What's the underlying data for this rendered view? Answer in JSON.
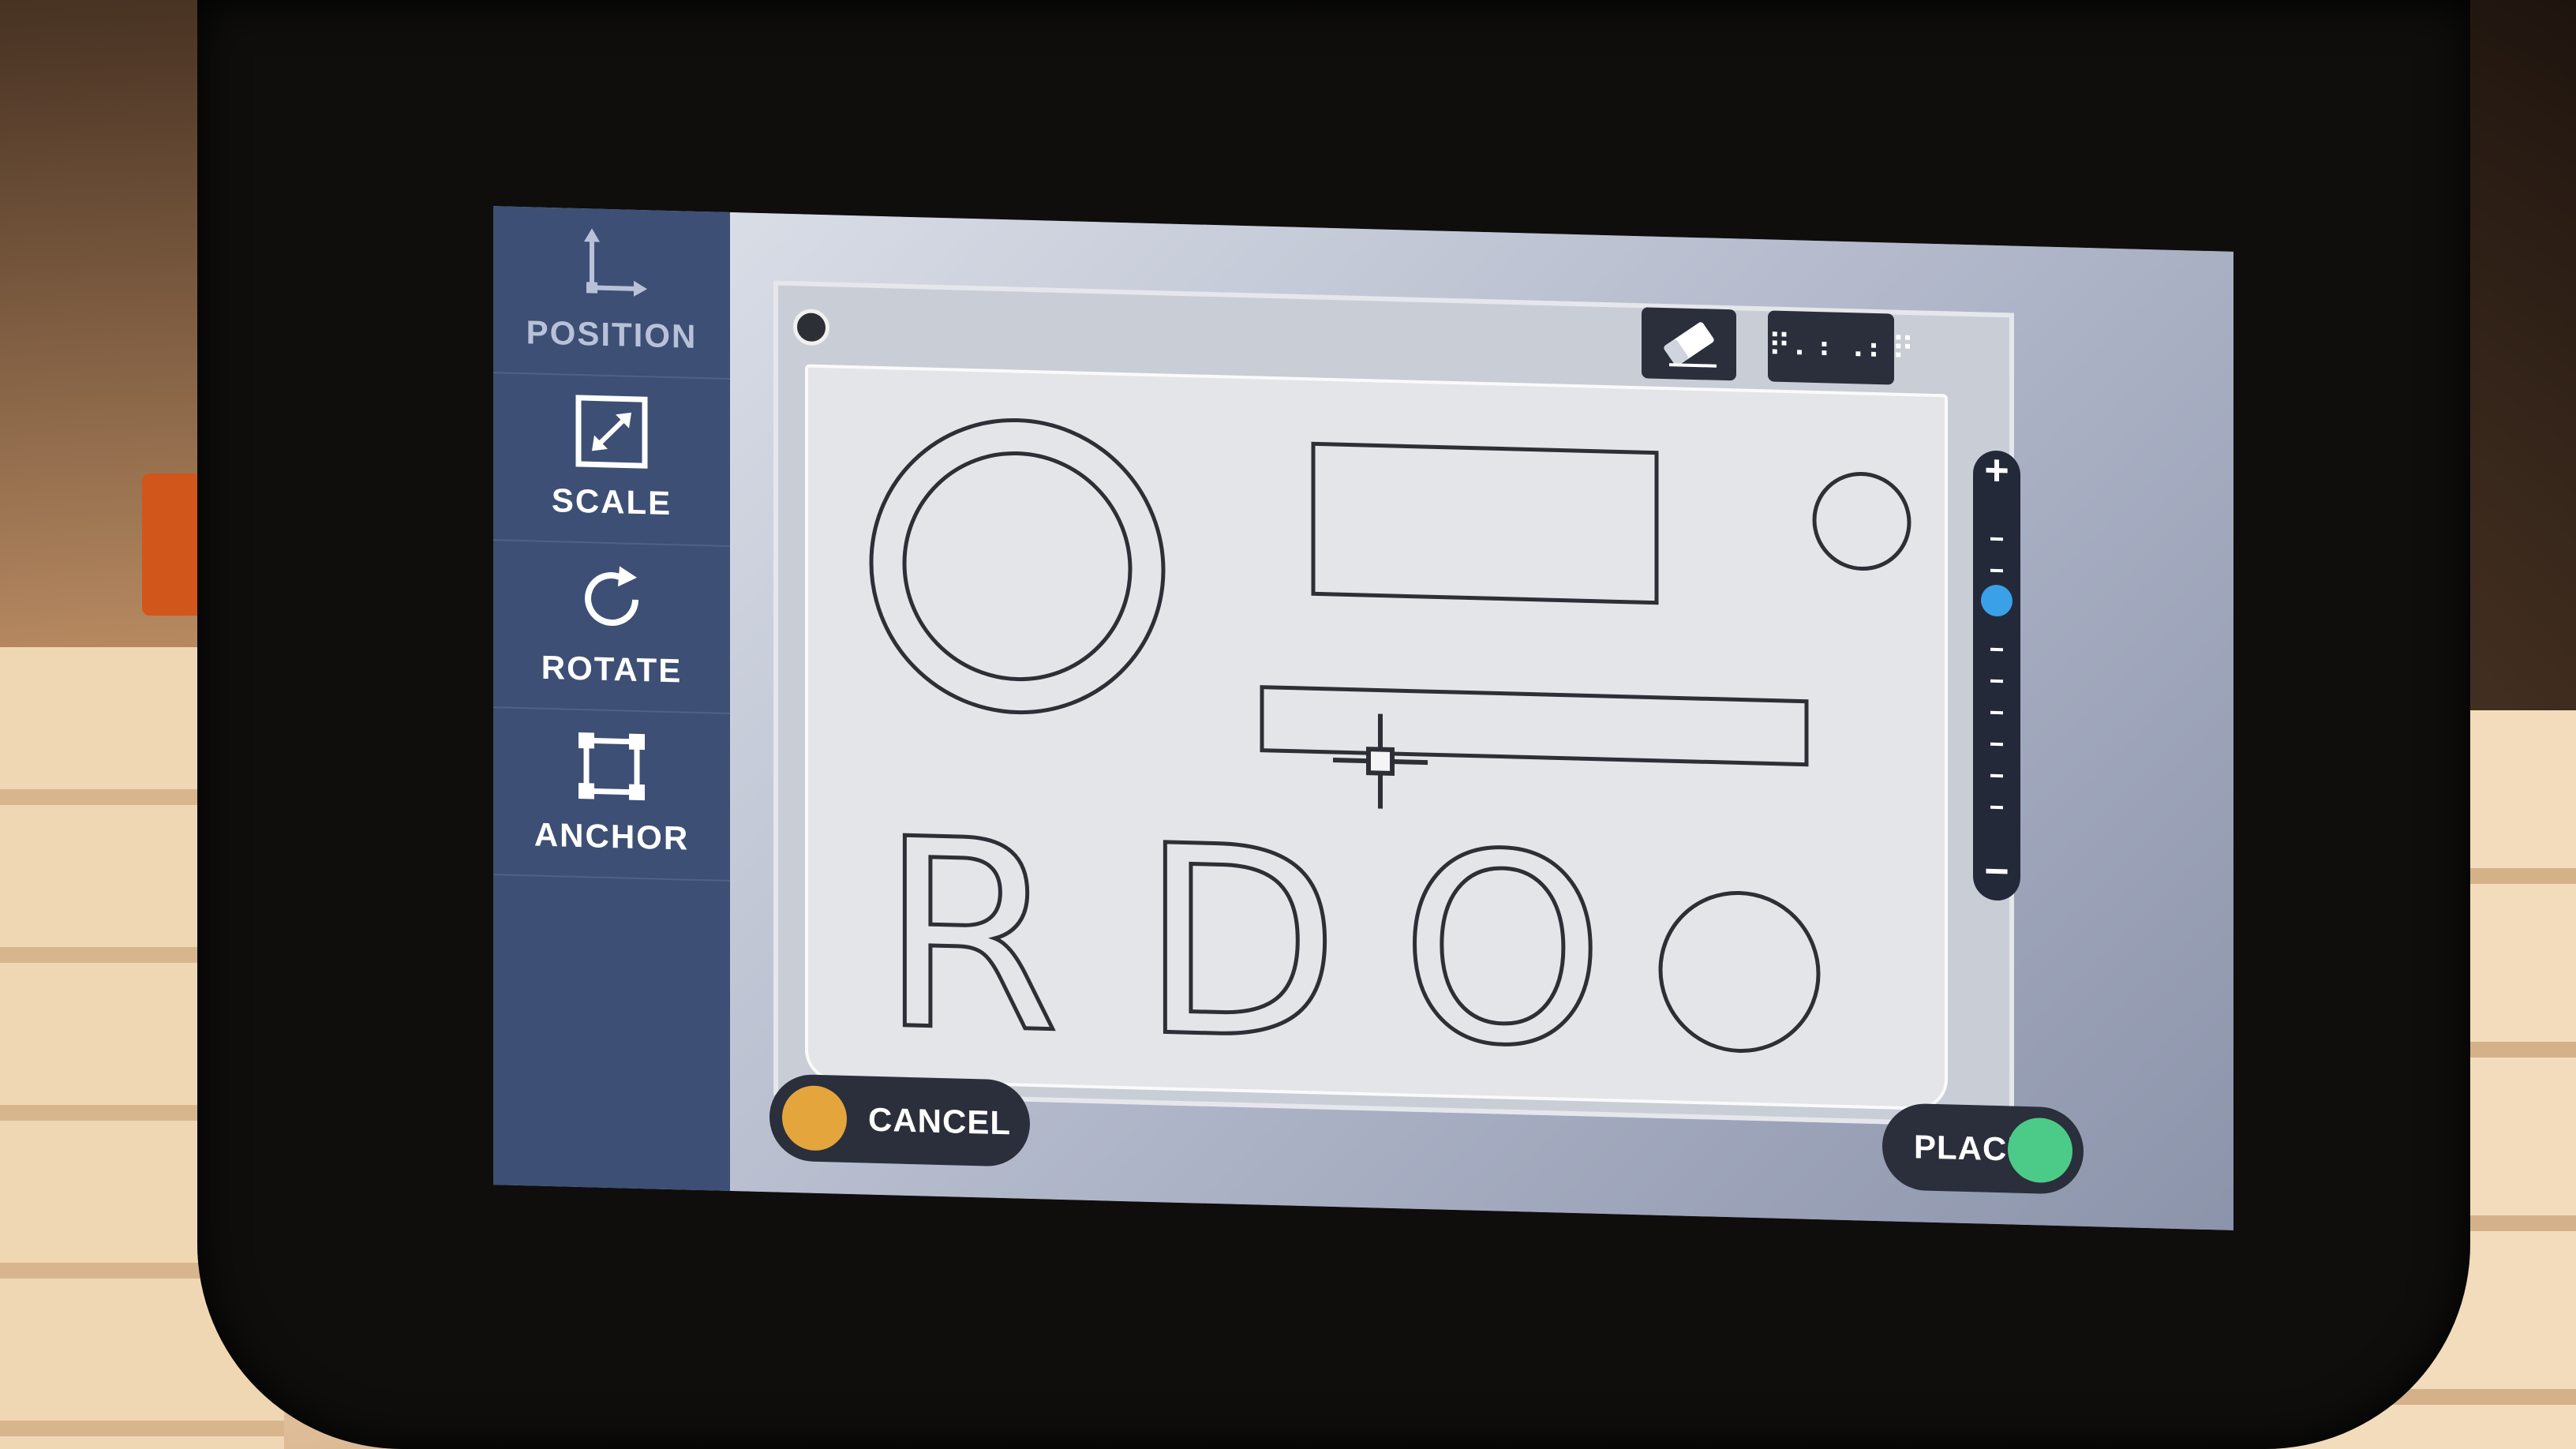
{
  "sidebar": {
    "tools": [
      {
        "label": "POSITION",
        "icon": "position-icon"
      },
      {
        "label": "SCALE",
        "icon": "scale-icon"
      },
      {
        "label": "ROTATE",
        "icon": "rotate-icon"
      },
      {
        "label": "ANCHOR",
        "icon": "anchor-icon"
      }
    ]
  },
  "workspace": {
    "design_letters": [
      "R",
      "D",
      "O"
    ]
  },
  "toolbar": {
    "eraser_icon": "eraser-icon",
    "braille_text": "⠟⠄⠆⠠⠆⠟"
  },
  "zoom": {
    "plus": "+",
    "minus": "−",
    "level": 0.75
  },
  "actions": {
    "cancel_label": "CANCEL",
    "place_label": "PLACE"
  },
  "colors": {
    "sidebar": "#3d4f74",
    "cancel_accent": "#e4a53c",
    "place_accent": "#4ccb88",
    "zoom_knob": "#3aa0e8"
  }
}
